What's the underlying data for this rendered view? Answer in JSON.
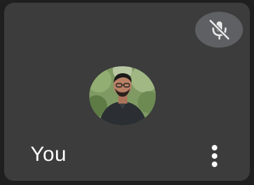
{
  "participant": {
    "name": "You",
    "avatar_icon": "person-photo",
    "microphone": {
      "state": "muted",
      "icon": "mic-off-icon"
    }
  },
  "actions": {
    "more_options_icon": "more-vert-icon"
  },
  "colors": {
    "tile_background": "#3c3c3c",
    "mute_badge": "#5f6063",
    "text": "#ffffff"
  }
}
